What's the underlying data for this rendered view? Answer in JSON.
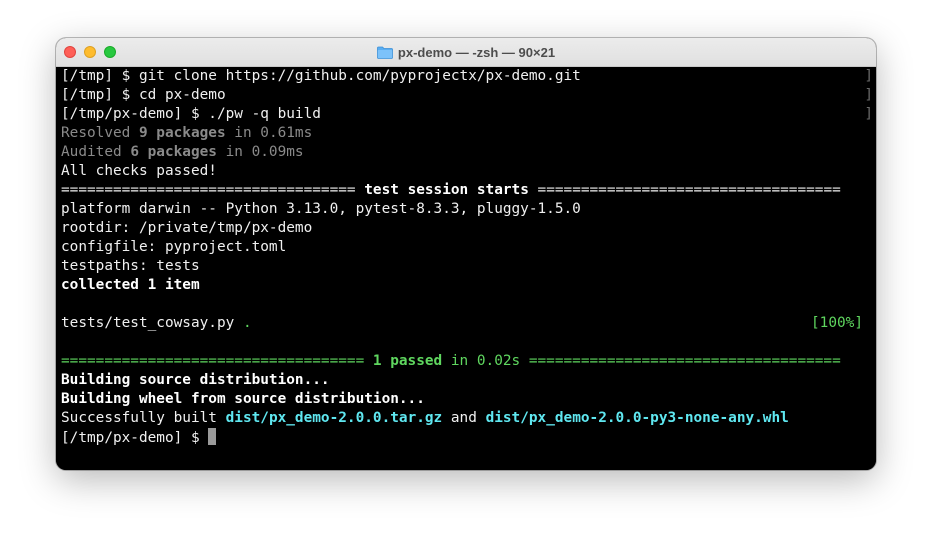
{
  "window": {
    "title": "px-demo — -zsh — 90×21",
    "folder_icon": "folder-icon"
  },
  "terminal": {
    "line1": {
      "prompt": "[/tmp] $ ",
      "command": "git clone https://github.com/pyprojectx/px-demo.git",
      "mark": "]"
    },
    "line2": {
      "prompt": "[/tmp] $ ",
      "command": "cd px-demo",
      "mark": "]"
    },
    "line3": {
      "prompt": "[/tmp/px-demo] $ ",
      "command": "./pw -q build",
      "mark": "]"
    },
    "resolved": {
      "pre": "Resolved ",
      "count": "9 packages",
      "post": " in 0.61ms"
    },
    "audited": {
      "pre": "Audited ",
      "count": "6 packages",
      "post": " in 0.09ms"
    },
    "checks": "All checks passed!",
    "session_left": "================================== ",
    "session_title": "test session starts",
    "session_right": " ===================================",
    "platform": "platform darwin -- Python 3.13.0, pytest-8.3.3, pluggy-1.5.0",
    "rootdir": "rootdir: /private/tmp/px-demo",
    "configfile": "configfile: pyproject.toml",
    "testpaths": "testpaths: tests",
    "collected": "collected 1 item",
    "test_file": "tests/test_cowsay.py ",
    "test_dot": ".",
    "test_pct": "[100%]",
    "result_left": "=================================== ",
    "result_passed": "1 passed",
    "result_time": " in 0.02s ",
    "result_right": "====================================",
    "build_src": "Building source distribution...",
    "build_wheel": "Building wheel from source distribution...",
    "built_pre": "Successfully built ",
    "built_sdist": "dist/px_demo-2.0.0.tar.gz",
    "built_and": " and ",
    "built_wheel": "dist/px_demo-2.0.0-py3-none-any.whl",
    "final_prompt": "[/tmp/px-demo] $ "
  }
}
